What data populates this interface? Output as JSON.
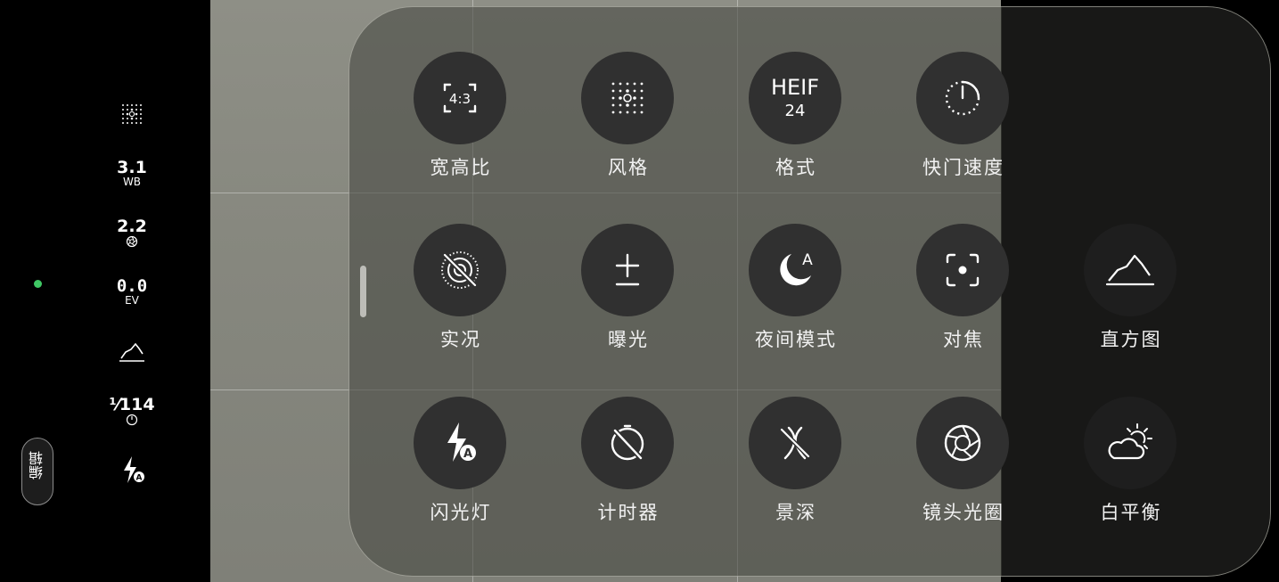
{
  "side_bar": {
    "wb": {
      "value": "3.1",
      "label": "WB"
    },
    "aperture": {
      "value": "2.2"
    },
    "ev": {
      "value": "0.0",
      "label": "EV"
    },
    "shutter": {
      "value": "¹⁄114"
    },
    "edit_label": "编辑"
  },
  "panel": {
    "rows": [
      [
        {
          "label": "宽高比",
          "icon": "aspect-ratio-icon",
          "text": "4:3"
        },
        {
          "label": "风格",
          "icon": "style-grid-icon"
        },
        {
          "label": "格式",
          "icon": "format-heif-icon",
          "text": "HEIF",
          "sub": "24"
        },
        {
          "label": "快门速度",
          "icon": "shutter-speed-icon"
        }
      ],
      [
        {
          "label": "实况",
          "icon": "live-photo-off-icon"
        },
        {
          "label": "曝光",
          "icon": "exposure-icon"
        },
        {
          "label": "夜间模式",
          "icon": "night-mode-icon",
          "text": "A"
        },
        {
          "label": "对焦",
          "icon": "focus-icon"
        },
        {
          "label": "直方图",
          "icon": "histogram-icon"
        }
      ],
      [
        {
          "label": "闪光灯",
          "icon": "flash-auto-icon"
        },
        {
          "label": "计时器",
          "icon": "timer-off-icon"
        },
        {
          "label": "景深",
          "icon": "depth-of-field-icon"
        },
        {
          "label": "镜头光圈",
          "icon": "aperture-icon"
        },
        {
          "label": "白平衡",
          "icon": "white-balance-icon"
        }
      ]
    ]
  },
  "colors": {
    "status_dot": "#3fc764",
    "tile_bg": "#303030"
  }
}
